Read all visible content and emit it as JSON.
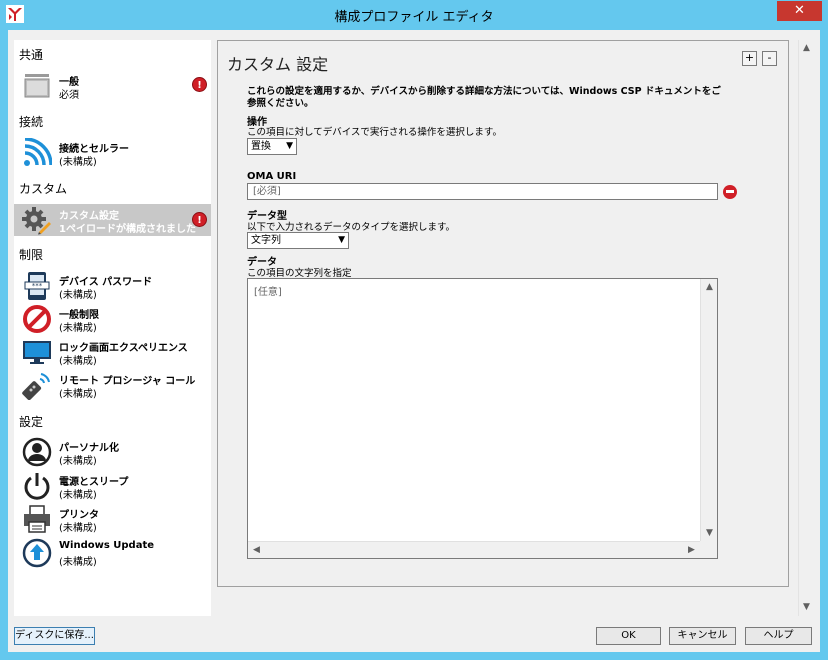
{
  "window": {
    "title": "構成プロファイル エディタ",
    "close_glyph": "✕",
    "accent_color": "#64c8ee"
  },
  "sidebar": {
    "sections": [
      {
        "header": "共通"
      },
      {
        "header": "接続"
      },
      {
        "header": "カスタム"
      },
      {
        "header": "制限"
      },
      {
        "header": "設定"
      }
    ],
    "items": [
      {
        "title": "一般",
        "subtitle": "必須",
        "icon": "general-icon",
        "badge": "!"
      },
      {
        "title": "接続とセルラー",
        "subtitle": "(未構成)",
        "icon": "wifi-icon"
      },
      {
        "title": "カスタム設定",
        "subtitle": "1ペイロードが構成されました",
        "icon": "gear-pencil-icon",
        "badge": "!",
        "selected": true
      },
      {
        "title": "デバイス パスワード",
        "subtitle": "(未構成)",
        "icon": "device-password-icon"
      },
      {
        "title": "一般制限",
        "subtitle": "(未構成)",
        "icon": "no-entry-icon"
      },
      {
        "title": "ロック画面エクスペリエンス",
        "subtitle": "(未構成)",
        "icon": "monitor-icon"
      },
      {
        "title": "リモート プロシージャ コール",
        "subtitle": "(未構成)",
        "icon": "remote-control-icon"
      },
      {
        "title": "パーソナル化",
        "subtitle": "(未構成)",
        "icon": "person-icon"
      },
      {
        "title": "電源とスリープ",
        "subtitle": "(未構成)",
        "icon": "power-icon"
      },
      {
        "title": "プリンタ",
        "subtitle": "(未構成)",
        "icon": "printer-icon"
      },
      {
        "title": "Windows Update",
        "subtitle": "(未構成)",
        "icon": "windows-update-icon"
      }
    ]
  },
  "panel": {
    "title": "カスタム 設定",
    "add_label": "+",
    "remove_label": "-",
    "intro": "これらの設定を適用するか、デバイスから削除する詳細な方法については、Windows CSP ドキュメントをご参照ください。",
    "operation": {
      "label": "操作",
      "description": "この項目に対してデバイスで実行される操作を選択します。",
      "value": "置換"
    },
    "oma_uri": {
      "label": "OMA URI",
      "placeholder": "[必須]"
    },
    "data_type": {
      "label": "データ型",
      "description": "以下で入力されるデータのタイプを選択します。",
      "value": "文字列"
    },
    "data": {
      "label": "データ",
      "description": "この項目の文字列を指定",
      "placeholder": "[任意]"
    }
  },
  "buttons": {
    "save": "ディスクに保存...",
    "ok": "OK",
    "cancel": "キャンセル",
    "help": "ヘルプ"
  }
}
